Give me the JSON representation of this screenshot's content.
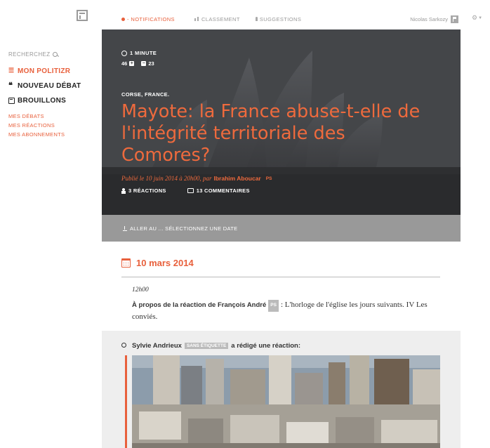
{
  "logo": {
    "icon": "politizr-logo-icon"
  },
  "sidebar": {
    "search_label": "RECHERCHEZ",
    "main_items": [
      {
        "label": "MON POLITIZR",
        "icon": "list-icon",
        "active": true
      },
      {
        "label": "NOUVEAU DÉBAT",
        "icon": "quote-icon",
        "active": false
      },
      {
        "label": "BROUILLONS",
        "icon": "document-icon",
        "active": false
      }
    ],
    "sub_items": [
      "MES DÉBATS",
      "MES RÉACTIONS",
      "MES ABONNEMENTS"
    ]
  },
  "topnav": {
    "notifications": "- NOTIFICATIONS",
    "classement": "CLASSEMENT",
    "suggestions": "SUGGESTIONS",
    "user_name": "Nicolas Sarkozy"
  },
  "hero": {
    "reading_time": "1 MINUTE",
    "votes_up": "46",
    "votes_down": "23",
    "tags": "CORSE, FRANCE.",
    "title": "Mayote: la France abuse-t-elle de l'intégrité territoriale des Comores?",
    "published_prefix": "Publié le 10 juin 2014 à 20h00, par",
    "author": "Ibrahim Aboucar",
    "author_party": "PS",
    "reactions": "3 RÉACTIONS",
    "comments": "13 COMMENTAIRES"
  },
  "datebar": {
    "label": "ALLER AU ... SÉLECTIONNEZ UNE DATE"
  },
  "timeline": {
    "date": "10 mars 2014",
    "entry": {
      "time": "12h00",
      "lead": "À propos de la réaction de François André",
      "party": "PS",
      "text": ": L'horloge de l'église les jours suivants. IV Les conviés."
    },
    "reaction": {
      "author": "Sylvie Andrieux",
      "badge": "SANS ÉTIQUETTE",
      "action": "a rédigé une réaction:"
    }
  },
  "colors": {
    "accent": "#e8603c",
    "hero_bg": "#3b3c40",
    "datebar": "#999999",
    "reaction_bg": "#eeeeee"
  }
}
